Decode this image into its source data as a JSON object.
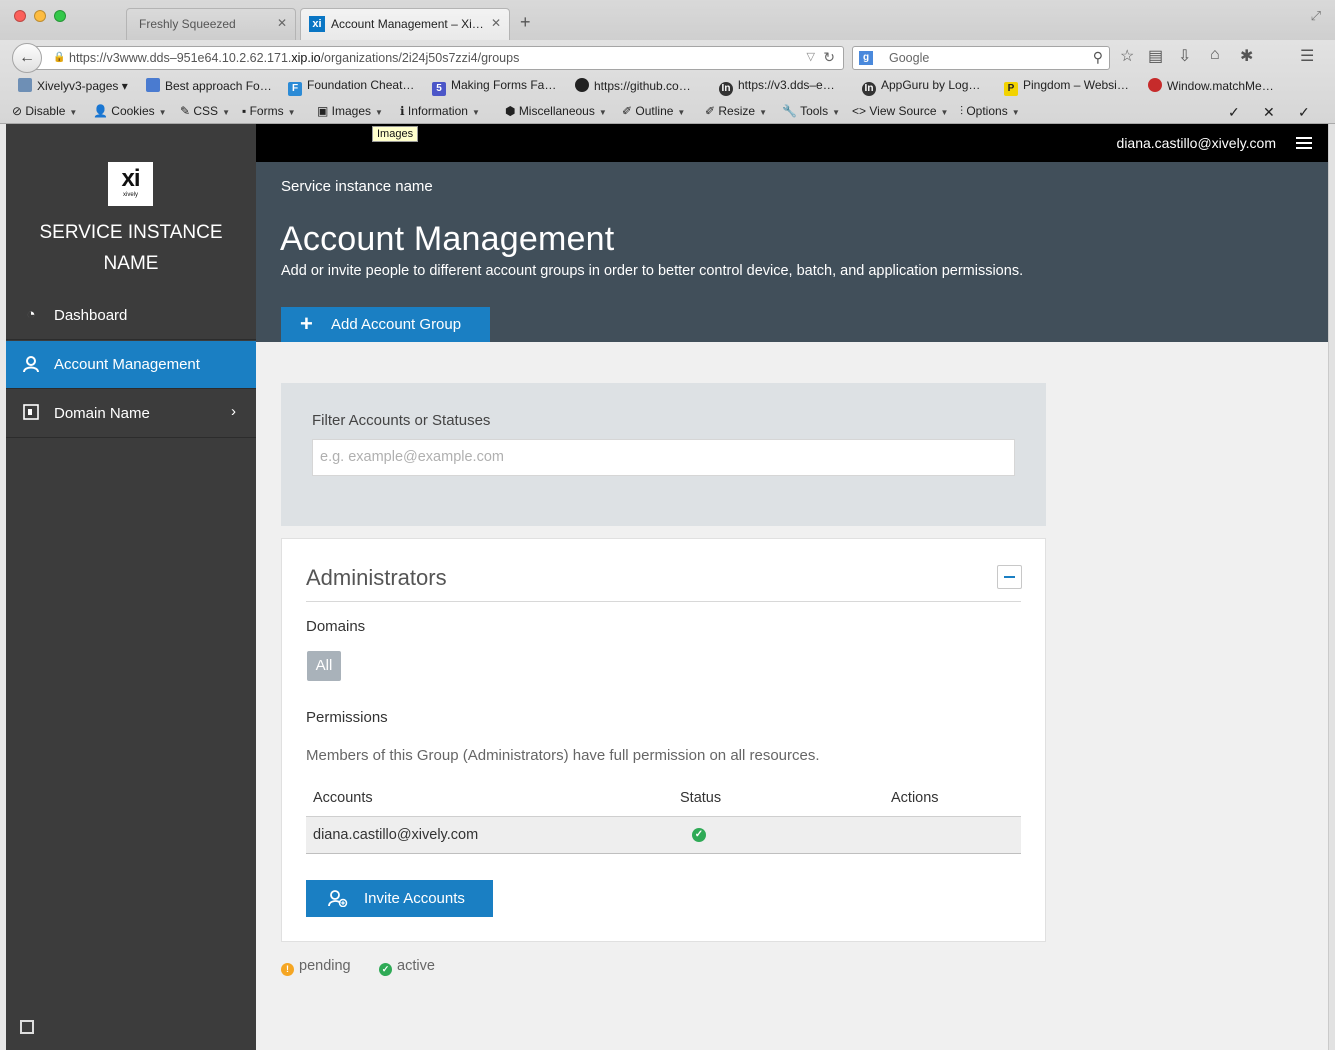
{
  "browser": {
    "tabs": [
      {
        "label": "Freshly Squeezed"
      },
      {
        "label": "Account Management – Xi…"
      }
    ],
    "url": {
      "prefix": "https://v3www.dds–951e64.10.2.62.171.",
      "host": "xip.io",
      "path": "/organizations/2i24j50s7zzi4/groups"
    },
    "search_placeholder": "Google",
    "bookmarks": [
      "Xivelyv3-pages",
      "Best approach Fo…",
      "Foundation Cheat…",
      "Making Forms Fa…",
      "https://github.co…",
      "https://v3.dds–e…",
      "AppGuru by Log…",
      "Pingdom – Websi…",
      "Window.matchMe…"
    ],
    "devbar": [
      "Disable",
      "Cookies",
      "CSS",
      "Forms",
      "Images",
      "Information",
      "Miscellaneous",
      "Outline",
      "Resize",
      "Tools",
      "View Source",
      "Options"
    ],
    "tooltip": "Images"
  },
  "sidebar": {
    "logo_mark": "xi",
    "logo_word": "xively",
    "instance_name": "SERVICE INSTANCE NAME",
    "items": [
      {
        "label": "Dashboard",
        "icon": "gauge-icon"
      },
      {
        "label": "Account Management",
        "icon": "user-icon",
        "active": true
      },
      {
        "label": "Domain Name",
        "icon": "domain-icon"
      }
    ]
  },
  "topbar": {
    "user_email": "diana.castillo@xively.com"
  },
  "hero": {
    "breadcrumb": "Service instance name",
    "title": "Account Management",
    "subtitle": "Add or invite people to different account groups in order to better control device, batch, and application permissions.",
    "add_button": "Add Account Group"
  },
  "filter": {
    "label": "Filter Accounts or Statuses",
    "placeholder": "e.g. example@example.com"
  },
  "group": {
    "title": "Administrators",
    "domains_label": "Domains",
    "domain_chip": "All",
    "permissions_label": "Permissions",
    "permissions_text": "Members of this Group (Administrators) have full permission on all resources.",
    "columns": [
      "Accounts",
      "Status",
      "Actions"
    ],
    "rows": [
      {
        "account": "diana.castillo@xively.com",
        "status": "active"
      }
    ],
    "invite_button": "Invite Accounts"
  },
  "legend": {
    "pending": "pending",
    "active": "active"
  },
  "colors": {
    "accent": "#1a7fc3",
    "hero": "#414f5a",
    "sidebar": "#3c3c3c",
    "active": "#2faa56",
    "pending": "#f5a623"
  }
}
